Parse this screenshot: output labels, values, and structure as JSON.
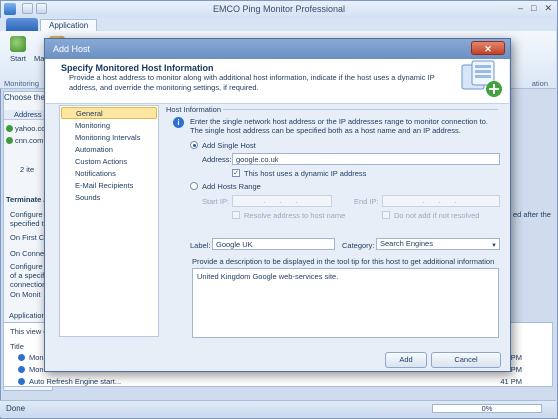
{
  "window": {
    "title": "EMCO Ping Monitor Professional"
  },
  "ribbon": {
    "tab": "Application",
    "buttons": [
      "Start",
      "Manual Acti..."
    ],
    "group_label": "Monitoring",
    "right_group_label": "ation"
  },
  "left_panel": {
    "caption": "Choose the h",
    "column": "Address",
    "hosts": [
      "yahoo.com",
      "cnn.com"
    ],
    "items_count": "2 ite",
    "terminate_label": "Terminate A",
    "config_lines": [
      "Configure the",
      "specified tim",
      "On First C",
      "On Conne",
      "Configure the",
      "of a specific",
      "connection s",
      "On Monit"
    ],
    "right_fragment": "ed after the"
  },
  "log": {
    "label": "Application Lo",
    "view_text": "This view c",
    "header": "Title",
    "rows": [
      "Monito",
      "Monito",
      "Auto Refresh Engine start..."
    ],
    "times": [
      "41 PM",
      "41 PM",
      "41 PM"
    ]
  },
  "status": {
    "text": "Done",
    "progress_label": "0%",
    "progress_fraction": 0.0
  },
  "dialog": {
    "title": "Add Host",
    "heading": "Specify Monitored Host Information",
    "description": "Provide a host address to monitor along with additional host information, indicate if the host uses a dynamic IP address, and override the monitoring settings, if required.",
    "nav": [
      "General",
      "Monitoring",
      "Monitoring Intervals",
      "Automation",
      "Custom Actions",
      "Notifications",
      "E-Mail Recipients",
      "Sounds"
    ],
    "selected_nav": "General",
    "section": "Host Information",
    "hint": "Enter the single network host address or the IP addresses range to monitor connection to. The single host address can be specified both as a host name and an IP address.",
    "add_single": "Add Single Host",
    "address_label": "Address:",
    "address_value": "google.co.uk",
    "dynamic_ip": "This host uses a dynamic IP address",
    "add_range": "Add Hosts Range",
    "start_ip": "Start IP:",
    "end_ip": "End IP:",
    "ip_placeholder": ". . .",
    "resolve": "Resolve address to host name",
    "do_not_add": "Do not add if not resolved",
    "label_label": "Label:",
    "label_value": "Google UK",
    "category_label": "Category:",
    "category_value": "Search Engines",
    "desc_prompt": "Provide a description to be displayed in the tool tip for this host to get additional information on it:",
    "desc_value": "United Kingdom Google web-services site.",
    "add_button": "Add",
    "cancel_button": "Cancel"
  }
}
